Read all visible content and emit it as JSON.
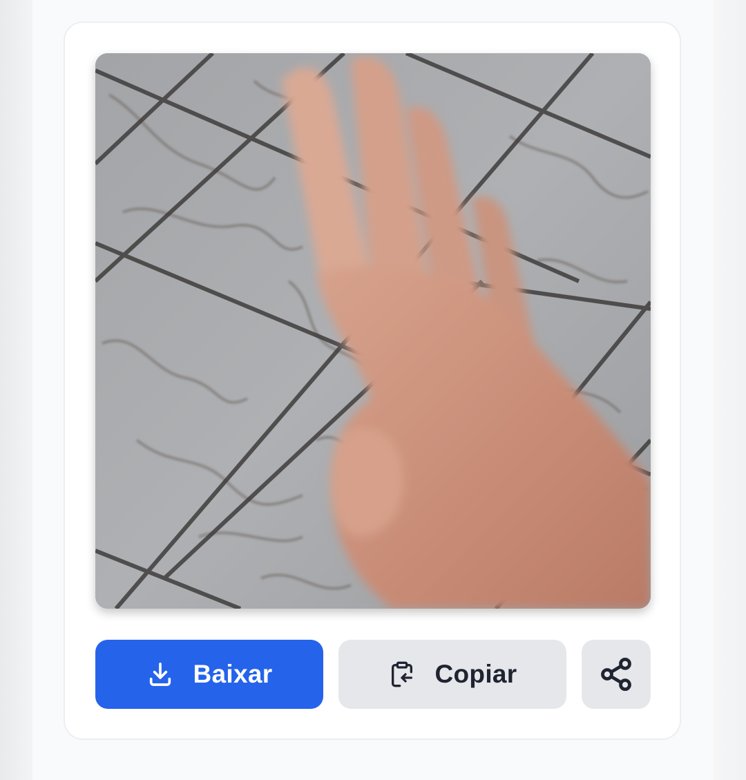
{
  "media": {
    "icon": "hand-over-tile-floor-image"
  },
  "actions": {
    "download_label": "Baixar",
    "download_icon": "download-icon",
    "copy_label": "Copiar",
    "copy_icon": "clipboard-copy-icon",
    "share_icon": "share-icon"
  },
  "colors": {
    "primary": "#2563eb",
    "secondary_button": "#e5e7eb",
    "card_background": "#ffffff",
    "page_background": "#f9fafb"
  }
}
